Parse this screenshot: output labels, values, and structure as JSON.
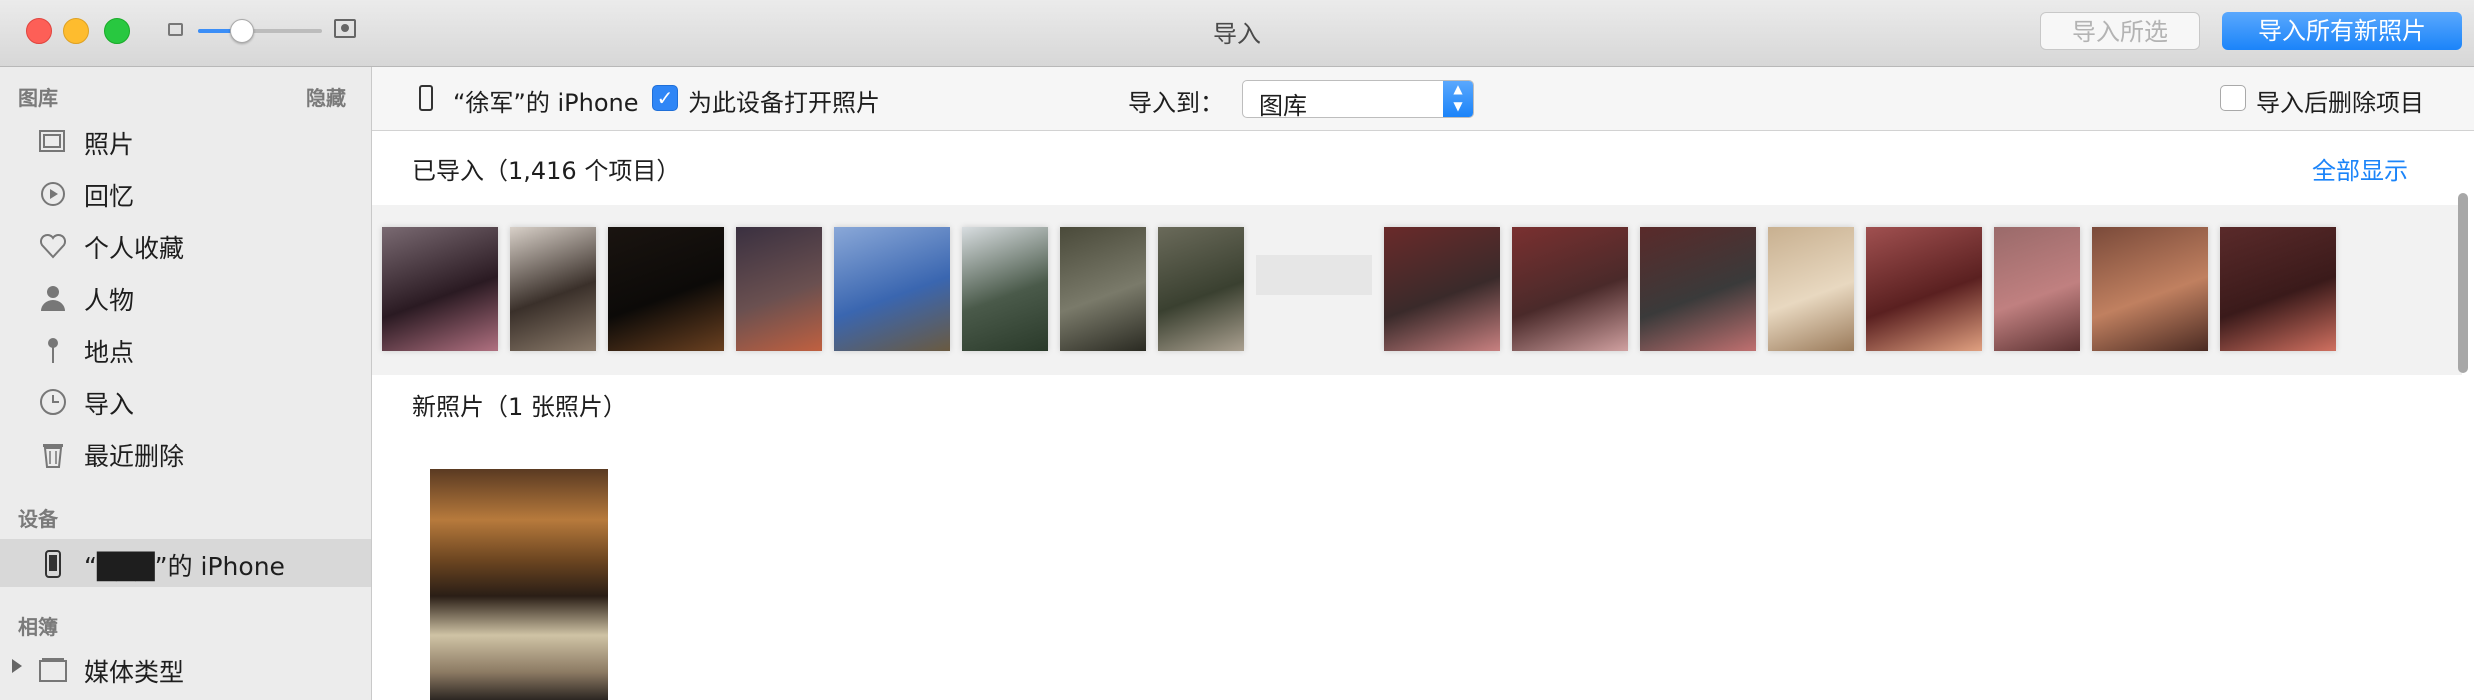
{
  "window": {
    "title": "导入",
    "import_selected_label": "导入所选",
    "import_all_label": "导入所有新照片",
    "zoom_level": 0.35
  },
  "sidebar": {
    "library_header": "图库",
    "hide_label": "隐藏",
    "items": [
      {
        "label": "照片",
        "icon": "photos-icon"
      },
      {
        "label": "回忆",
        "icon": "memories-icon"
      },
      {
        "label": "个人收藏",
        "icon": "heart-icon"
      },
      {
        "label": "人物",
        "icon": "person-icon"
      },
      {
        "label": "地点",
        "icon": "pin-icon"
      },
      {
        "label": "导入",
        "icon": "clock-icon"
      },
      {
        "label": "最近删除",
        "icon": "trash-icon"
      }
    ],
    "devices_header": "设备",
    "device_label": "“███”的 iPhone",
    "albums_header": "相簿",
    "media_types_label": "媒体类型"
  },
  "toolbar": {
    "device_name": "“徐军”的 iPhone",
    "open_photos_label": "为此设备打开照片",
    "open_photos_checked": true,
    "import_to_label": "导入到：",
    "import_to_value": "图库",
    "delete_after_label": "导入后删除项目",
    "delete_after_checked": false
  },
  "imported": {
    "title": "已导入（1,416 个项目）",
    "show_all_label": "全部显示",
    "thumbnails": [
      {
        "kind": "landscape",
        "colors": [
          "#7a6a72",
          "#2a1a22",
          "#b07080"
        ]
      },
      {
        "kind": "portrait",
        "colors": [
          "#d8d0c8",
          "#3a302a",
          "#8a7a6a"
        ]
      },
      {
        "kind": "landscape",
        "colors": [
          "#1a1410",
          "#0c0a08",
          "#6a4020"
        ]
      },
      {
        "kind": "portrait",
        "colors": [
          "#3a3040",
          "#6a5050",
          "#c06040"
        ]
      },
      {
        "kind": "landscape",
        "colors": [
          "#8aa8d8",
          "#3a66b0",
          "#6a5a40"
        ]
      },
      {
        "kind": "portrait",
        "colors": [
          "#d8dde0",
          "#4a5a4a",
          "#2a3a2a"
        ]
      },
      {
        "kind": "portrait",
        "colors": [
          "#4a4a3a",
          "#7a7a6a",
          "#2a2a22"
        ]
      },
      {
        "kind": "portrait",
        "colors": [
          "#6a6a5a",
          "#3a4030",
          "#aaa090"
        ]
      },
      {
        "kind": "landscape",
        "colors": [
          "#f2f2f2",
          "#e0e0e0",
          "#f2f2f2"
        ]
      },
      {
        "kind": "landscape",
        "colors": [
          "#6a2a2a",
          "#3a2a2a",
          "#c88080"
        ]
      },
      {
        "kind": "landscape",
        "colors": [
          "#7a3030",
          "#4a2a2a",
          "#d0a0a0"
        ]
      },
      {
        "kind": "landscape",
        "colors": [
          "#5a2a2a",
          "#3a3a3a",
          "#c07070"
        ]
      },
      {
        "kind": "portrait",
        "colors": [
          "#c8b090",
          "#e8d8c0",
          "#9a7a5a"
        ]
      },
      {
        "kind": "landscape",
        "colors": [
          "#a05050",
          "#5a2020",
          "#e0a080"
        ]
      },
      {
        "kind": "portrait",
        "colors": [
          "#9a6a6a",
          "#c08080",
          "#5a3030"
        ]
      },
      {
        "kind": "landscape",
        "colors": [
          "#7a4a3a",
          "#c08060",
          "#4a2a22"
        ]
      },
      {
        "kind": "landscape",
        "colors": [
          "#5a2a2a",
          "#3a1a1a",
          "#d07060"
        ]
      }
    ]
  },
  "new_photos": {
    "title": "新照片（1 张照片）"
  }
}
